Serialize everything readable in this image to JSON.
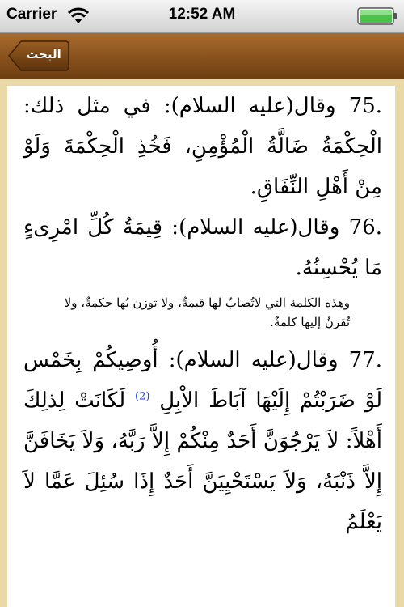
{
  "status_bar": {
    "carrier": "Carrier",
    "time": "12:52 AM",
    "battery_color": "#4cc24a"
  },
  "nav_bar": {
    "back_label": "البحث",
    "bar_color": "#8d551f"
  },
  "content": {
    "sayings": [
      {
        "number": "75.",
        "text": "وقال(عليه السلام): في مثل ذلك: الْحِكْمَةُ ضَالَّةُ الْمُؤْمِنِ، فَخُذِ الْحِكْمَةَ وَلَوْ مِنْ أَهْلِ النِّفَاقِ."
      },
      {
        "number": "76.",
        "text": "وقال(عليه السلام): قِيمَةُ كُلِّ امْرِىءٍ مَا يُحْسِنُهُ."
      },
      {
        "number": "77.",
        "text_before_ref": "وقال(عليه السلام): أُوصِيكُمْ بِخَمْس لَوْ ضَرَبْتُمْ إِلَيْهَا آبَاطَ الاْبِلِ",
        "footnote_ref": "(2)",
        "text_after_ref": "لَكَانَتْ لِذلِكَ أَهْلاً: لاَ يَرْجُوَنَّ أَحَدٌ مِنْكُمْ إِلاَّ رَبَّهُ، وَلاَ يَخَافَنَّ إِلاَّ ذَنْبَهُ، وَلاَ يَسْتَحْيِيَنَّ أَحَدٌ إِذَا سُئِلَ عَمَّا لاَ يَعْلَمُ"
      }
    ],
    "explanation": "وهذه الكلمة التي لاتُصابُ لها قيمةٌ، ولا توزن بُها حكمةٌ، ولا تُقرنُ إليها كلمةٌ."
  }
}
